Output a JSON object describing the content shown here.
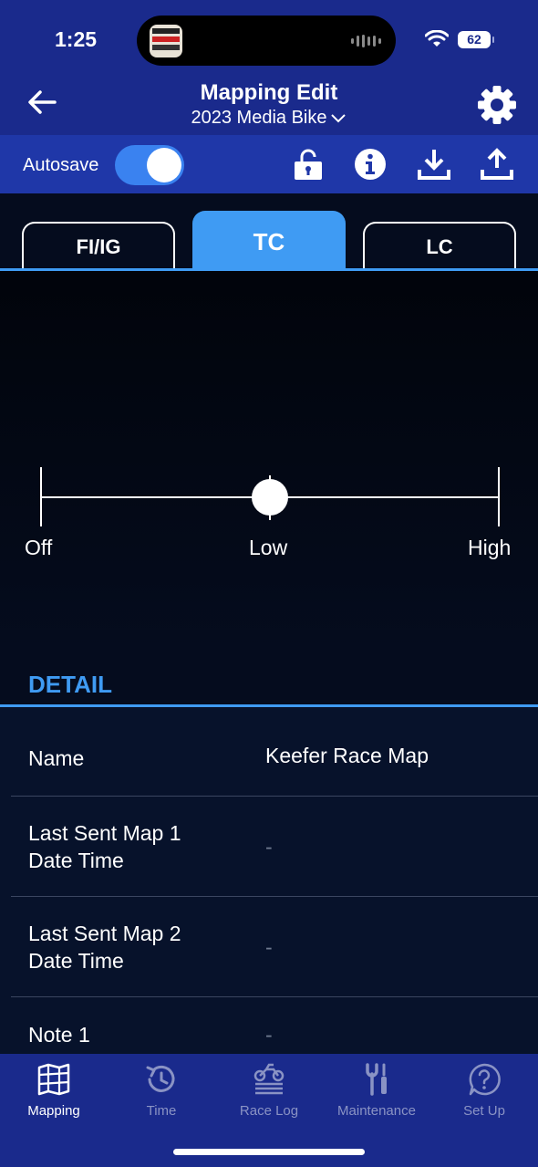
{
  "status_bar": {
    "time": "1:25",
    "battery": "62",
    "icons": [
      "classic-rewind-app-icon",
      "audio-wave-icon",
      "wifi-icon",
      "battery-icon"
    ]
  },
  "nav": {
    "title": "Mapping Edit",
    "subtitle": "2023 Media Bike",
    "icons": [
      "back-arrow-icon",
      "chevron-down-icon",
      "gear-icon"
    ]
  },
  "toolbar": {
    "autosave_label": "Autosave",
    "autosave_on": true,
    "icons": [
      "unlock-icon",
      "info-icon",
      "download-icon",
      "upload-icon"
    ]
  },
  "tabs": [
    {
      "label": "FI/IG",
      "active": false
    },
    {
      "label": "TC",
      "active": true
    },
    {
      "label": "LC",
      "active": false
    }
  ],
  "tc": {
    "levels": [
      "Off",
      "Low",
      "High"
    ],
    "selected": "Low"
  },
  "detail": {
    "title": "DETAIL",
    "rows": [
      {
        "key_line1": "Name",
        "key_line2": "",
        "value": "Keefer Race Map"
      },
      {
        "key_line1": "Last Sent Map 1",
        "key_line2": "Date Time",
        "value": "-"
      },
      {
        "key_line1": "Last Sent Map 2",
        "key_line2": "Date Time",
        "value": "-"
      },
      {
        "key_line1": "Note 1",
        "key_line2": "",
        "value": "-"
      }
    ]
  },
  "tabbar": [
    {
      "label": "Mapping",
      "icon": "map-grid-icon",
      "active": true
    },
    {
      "label": "Time",
      "icon": "stopwatch-icon",
      "active": false
    },
    {
      "label": "Race Log",
      "icon": "motorcycle-log-icon",
      "active": false
    },
    {
      "label": "Maintenance",
      "icon": "tools-icon",
      "active": false
    },
    {
      "label": "Set Up",
      "icon": "help-bubble-icon",
      "active": false
    }
  ],
  "colors": {
    "header": "#1a2a8c",
    "toolbar": "#1f37a8",
    "accent": "#3f9bf3",
    "background": "#050c1e"
  }
}
